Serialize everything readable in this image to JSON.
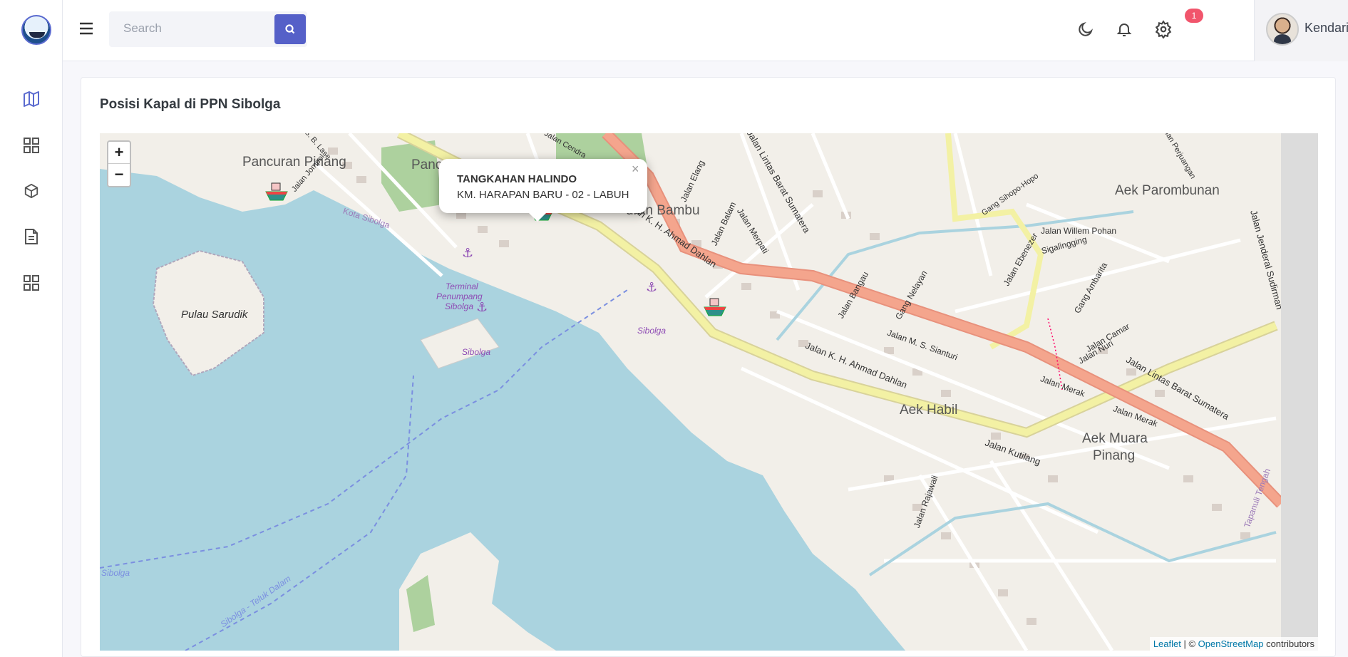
{
  "header": {
    "search_placeholder": "Search",
    "notification_count": "1",
    "user_name": "Kendariweb",
    "user_caret": "⌄"
  },
  "sidebar": {
    "items": [
      {
        "icon": "map-icon"
      },
      {
        "icon": "grid-icon"
      },
      {
        "icon": "box-icon"
      },
      {
        "icon": "document-icon"
      },
      {
        "icon": "apps-icon"
      }
    ]
  },
  "card": {
    "title": "Posisi Kapal di PPN Sibolga"
  },
  "map": {
    "zoom_in": "+",
    "zoom_out": "−",
    "popup": {
      "title": "TANGKAHAN HALINDO",
      "subtitle": "KM. HARAPAN BARU - 02 - LABUH",
      "close": "×"
    },
    "attribution": {
      "leaflet": "Leaflet",
      "separator": " | © ",
      "osm": "OpenStreetMap",
      "suffix": " contributors"
    },
    "labels": {
      "pancuran_pinang": "Pancuran Pinang",
      "pancuran_partial": "Panc",
      "bambu": "uran Bambu",
      "pulau_sarudik": "Pulau Sarudik",
      "terminal1": "Terminal",
      "terminal2": "Penumpang",
      "terminal3": "Sibolga",
      "sibolga_port": "Sibolga",
      "sibolga_port2": "Sibolga",
      "kota_sibolga": "Kota Sibolga",
      "jalan_kh_ahmad_dahlan": "Jalan K. H. Ahmad Dahlan",
      "jalan_kh_ahmad_dahlan2": "Jalan K. H. Ahmad Dahlan",
      "jalan_lintas_barat": "Jalan Lintas Barat Sumatera",
      "jalan_lintas_barat2": "Jalan Lintas Barat Sumatera",
      "aek_habil": "Aek Habil",
      "aek_muara1": "Aek Muara",
      "aek_muara2": "Pinang",
      "aek_parombunan": "Aek Parombunan",
      "jalan_kutilang": "Jalan Kutilang",
      "jalan_merpati": "Jalan Merpati",
      "jalan_balam": "Jalan Balam",
      "jalan_elang": "Jalan Elang",
      "jalan_bangau": "Jalan Bangau",
      "jalan_nelayan": "Gang Nelayan",
      "jalan_ms_sianturi": "Jalan M. S. Sianturi",
      "jalan_willem": "Jalan Willem Pohan",
      "jalan_ebenezer": "Jalan Ebenezer",
      "sigalingging": "Sigalingging",
      "gang_ambarita": "Gang Ambarita",
      "jalan_camar": "Jalan Camar",
      "jalan_nuri": "Jalan Nuri",
      "jalan_merak": "Jalan Merak",
      "jalan_merak2": "Jalan Merak",
      "jalan_jenderal": "Jalan Jenderal Sudirman",
      "jalan_rajawali": "Jalan Rajawali",
      "tapanuli": "Tapanuli Tengah",
      "sibolga_west": "Sibolga",
      "teluk_dalam": "Sibolga - Teluk Dalam",
      "jalan_jompol": "Jalan Jompol",
      "sibolga_lase": "S. B. Lase",
      "gang_sihopo": "Gang Sihopo-Hopo",
      "jalan_cendra": "Jalan Cendra",
      "jalan_perjuangan": "Jalan Perjuangan"
    }
  },
  "colors": {
    "accent": "#5560c8",
    "water": "#aad3df",
    "land": "#f2efe9",
    "primary_road": "#f4a58d",
    "secondary_road": "#f3f1a4",
    "park": "#add19e",
    "badge": "#f1556c"
  }
}
